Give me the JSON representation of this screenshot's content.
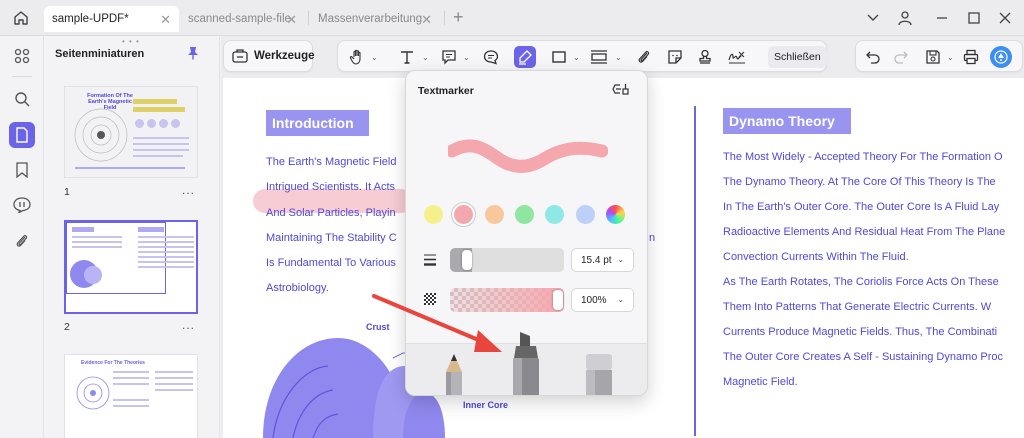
{
  "tabs": [
    {
      "label": "sample-UPDF*",
      "active": true
    },
    {
      "label": "scanned-sample-file",
      "active": false
    },
    {
      "label": "Massenverarbeitung",
      "active": false
    }
  ],
  "sidebar": {
    "panel_title": "Seitenminiaturen",
    "pages": [
      {
        "number": "1",
        "thumb_title": "Formation Of The Earth's Magnetic Field"
      },
      {
        "number": "2"
      },
      {
        "number": "",
        "thumb_title": "Evidence For The Theories"
      }
    ],
    "more": "..."
  },
  "toolbar": {
    "tools_label": "Werkzeuge",
    "close_label": "Schließen"
  },
  "document": {
    "intro_heading": "Introduction",
    "intro_lines": [
      "The Earth's Magnetic Field",
      "Intrigued Scientists. It Acts",
      "And Solar Particles, Playin",
      "Maintaining The Stability C",
      "Is Fundamental To Various",
      "Astrobiology."
    ],
    "intro_right_fragments": [
      "n"
    ],
    "labels": {
      "crust": "Crust",
      "inner_core": "Inner Core"
    },
    "dynamo_heading": "Dynamo Theory",
    "dynamo_lines": [
      "The Most Widely - Accepted Theory For The Formation O",
      "The Dynamo Theory. At The Core Of This Theory Is The",
      "In The Earth's Outer Core. The Outer Core Is A Fluid Lay",
      "Radioactive Elements And Residual Heat From The Plane",
      "Convection Currents Within The Fluid.",
      "As The Earth Rotates, The Coriolis Force Acts On These",
      "Them Into Patterns That Generate Electric Currents. W",
      "Currents Produce Magnetic Fields. Thus, The Combinati",
      "The Outer Core Creates A Self - Sustaining Dynamo Proc",
      "Magnetic Field."
    ]
  },
  "popup": {
    "title": "Textmarker",
    "stroke_color": "#f4a7ad",
    "colors": [
      "#f5f08b",
      "#f4a7ad",
      "#f8c79c",
      "#8fe6a0",
      "#8ee8e6",
      "#bcd0f8",
      "rainbow"
    ],
    "selected_color_index": 1,
    "thickness": {
      "value": "15.4 pt",
      "fraction": 0.12
    },
    "opacity": {
      "value": "100%",
      "fraction": 1.0
    }
  },
  "colors": {
    "accent": "#6b63e8",
    "heading_bg": "#9a94f1",
    "body_text": "#4f49d9",
    "annotation_arrow": "#e8453c"
  }
}
